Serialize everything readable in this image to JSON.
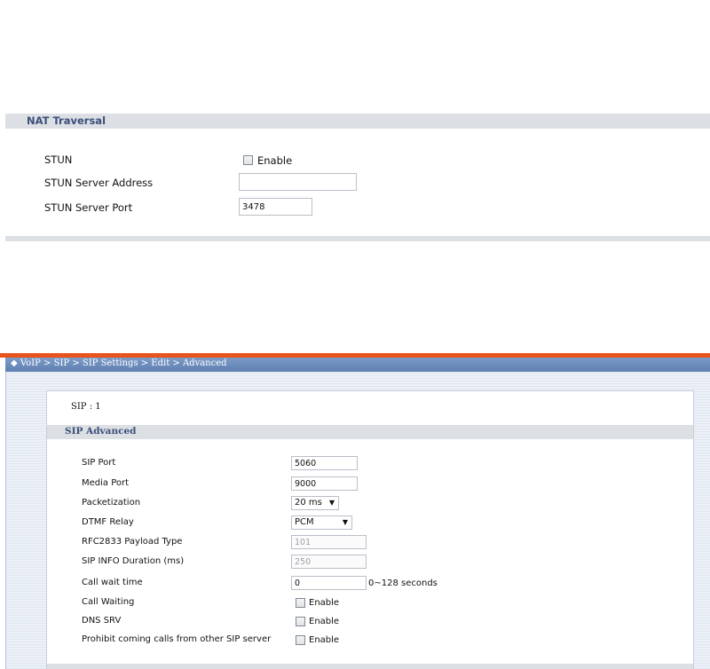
{
  "nat": {
    "section_title": "NAT Traversal",
    "stun_label": "STUN",
    "stun_enable_label": "Enable",
    "stun_server_address_label": "STUN Server Address",
    "stun_server_address_value": "",
    "stun_server_port_label": "STUN Server Port",
    "stun_server_port_value": "3478"
  },
  "sip_window": {
    "breadcrumb": "◆ VoIP > SIP > SIP Settings > Edit > Advanced",
    "sip_id_label": "SIP : 1",
    "section_title": "SIP Advanced",
    "sip_port_label": "SIP Port",
    "sip_port_value": "5060",
    "media_port_label": "Media Port",
    "media_port_value": "9000",
    "packetization_label": "Packetization",
    "packetization_value": "20 ms",
    "dtmf_relay_label": "DTMF Relay",
    "dtmf_relay_value": "PCM",
    "rfc2833_label": "RFC2833 Payload Type",
    "rfc2833_value": "101",
    "sip_info_label": "SIP INFO Duration (ms)",
    "sip_info_value": "250",
    "call_wait_time_label": "Call wait time",
    "call_wait_time_value": "0",
    "call_wait_time_unit": "0~128 seconds",
    "call_waiting_label": "Call Waiting",
    "call_waiting_enable": "Enable",
    "dns_srv_label": "DNS SRV",
    "dns_srv_enable": "Enable",
    "prohibit_label": "Prohibit coming calls from other SIP server",
    "prohibit_enable": "Enable"
  },
  "colors": {
    "accent_orange": "#e8541c",
    "title_bar_blue": "#6a8bbd",
    "section_header_gray": "#dcdfe3",
    "section_title_blue": "#3b4f7a"
  }
}
